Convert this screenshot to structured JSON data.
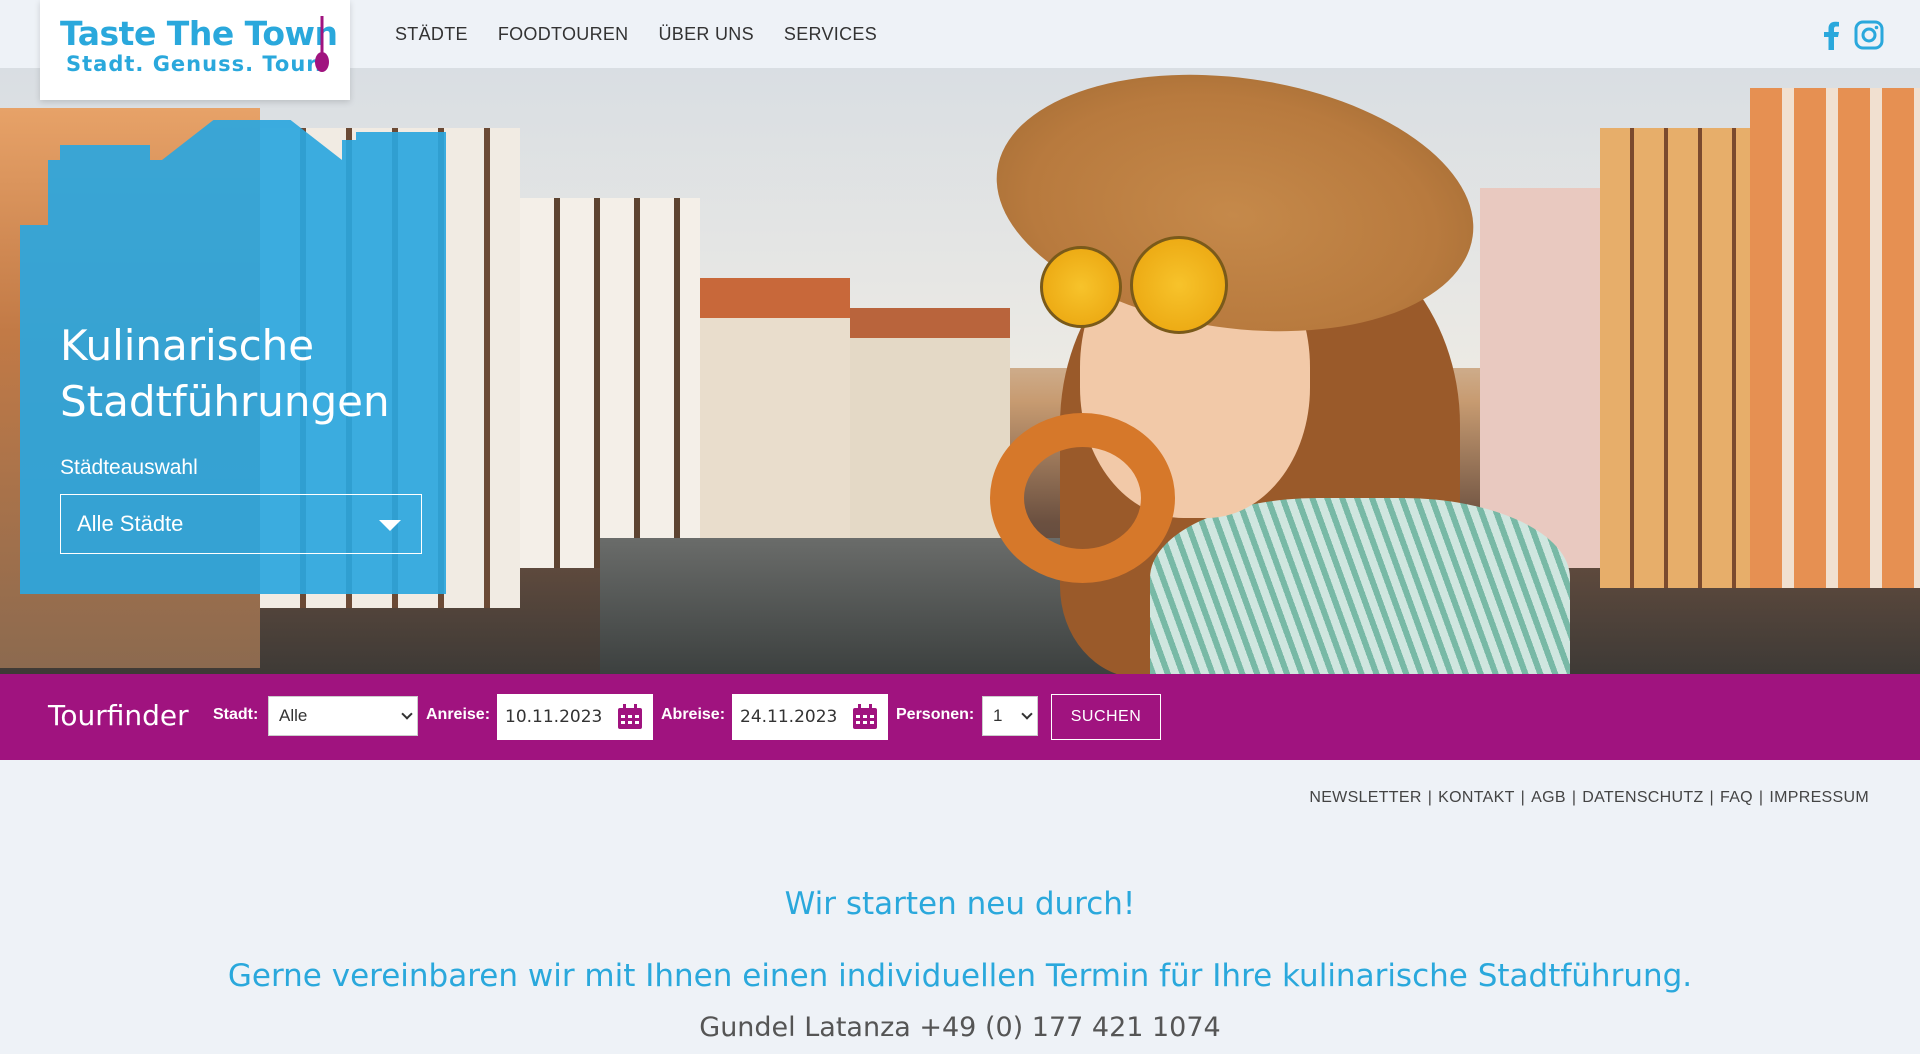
{
  "brand": {
    "title": "Taste The Town",
    "tagline": "Stadt. Genuss. Tour.",
    "primary_color": "#2aa8dc",
    "accent_color": "#a0137f"
  },
  "nav": {
    "items": [
      "STÄDTE",
      "FOODTOUREN",
      "ÜBER UNS",
      "SERVICES"
    ]
  },
  "social": {
    "icons": [
      "facebook-icon",
      "instagram-icon"
    ]
  },
  "hero": {
    "title_line1": "Kulinarische",
    "title_line2": "Stadtführungen",
    "city_label": "Städteauswahl",
    "city_value": "Alle Städte"
  },
  "tourfinder": {
    "title": "Tourfinder",
    "city_label": "Stadt:",
    "city_value": "Alle",
    "arrival_label": "Anreise:",
    "arrival_value": "10.11.2023",
    "departure_label": "Abreise:",
    "departure_value": "24.11.2023",
    "persons_label": "Personen:",
    "persons_value": "1",
    "search_label": "SUCHEN"
  },
  "footer_links": [
    "NEWSLETTER",
    "KONTAKT",
    "AGB",
    "DATENSCHUTZ",
    "FAQ",
    "IMPRESSUM"
  ],
  "content": {
    "headline": "Wir starten neu durch!",
    "subheadline": "Gerne vereinbaren wir mit Ihnen einen individuellen Termin für Ihre kulinarische Stadtführung.",
    "contact": "Gundel Latanza +49 (0) 177 421 1074"
  }
}
